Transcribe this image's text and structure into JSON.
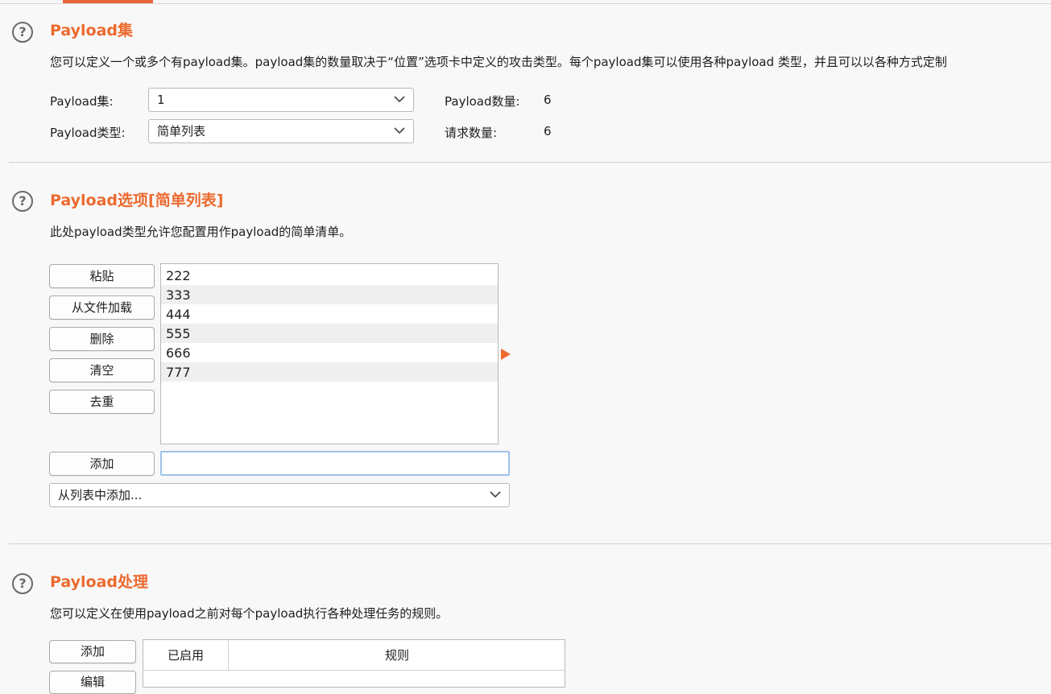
{
  "colors": {
    "accent": "#ec6a2f",
    "focus_border": "#9fc3ea"
  },
  "section_payload_sets": {
    "title": "Payload集",
    "description": "您可以定义一个或多个有payload集。payload集的数量取决于“位置”选项卡中定义的攻击类型。每个payload集可以使用各种payload 类型，并且可以以各种方式定制",
    "set_label": "Payload集:",
    "set_value": "1",
    "type_label": "Payload类型:",
    "type_value": "简单列表",
    "count_label": "Payload数量:",
    "count_value": "6",
    "requests_label": "请求数量:",
    "requests_value": "6"
  },
  "section_payload_options": {
    "title": "Payload选项[简单列表]",
    "description": "此处payload类型允许您配置用作payload的简单清单。",
    "buttons": {
      "paste": "粘贴",
      "load": "从文件加载",
      "remove": "删除",
      "clear": "清空",
      "dedupe": "去重",
      "add": "添加"
    },
    "items": [
      "222",
      "333",
      "444",
      "555",
      "666",
      "777"
    ],
    "add_input_value": "",
    "add_from_list": "从列表中添加..."
  },
  "section_payload_processing": {
    "title": "Payload处理",
    "description": "您可以定义在使用payload之前对每个payload执行各种处理任务的规则。",
    "add_button": "添加",
    "edit_button_partial": "编辑",
    "columns": [
      "已启用",
      "规则"
    ]
  },
  "icons": {
    "help": "help-circle-icon",
    "dropdown": "chevron-down-icon",
    "start": "play-triangle-icon"
  }
}
